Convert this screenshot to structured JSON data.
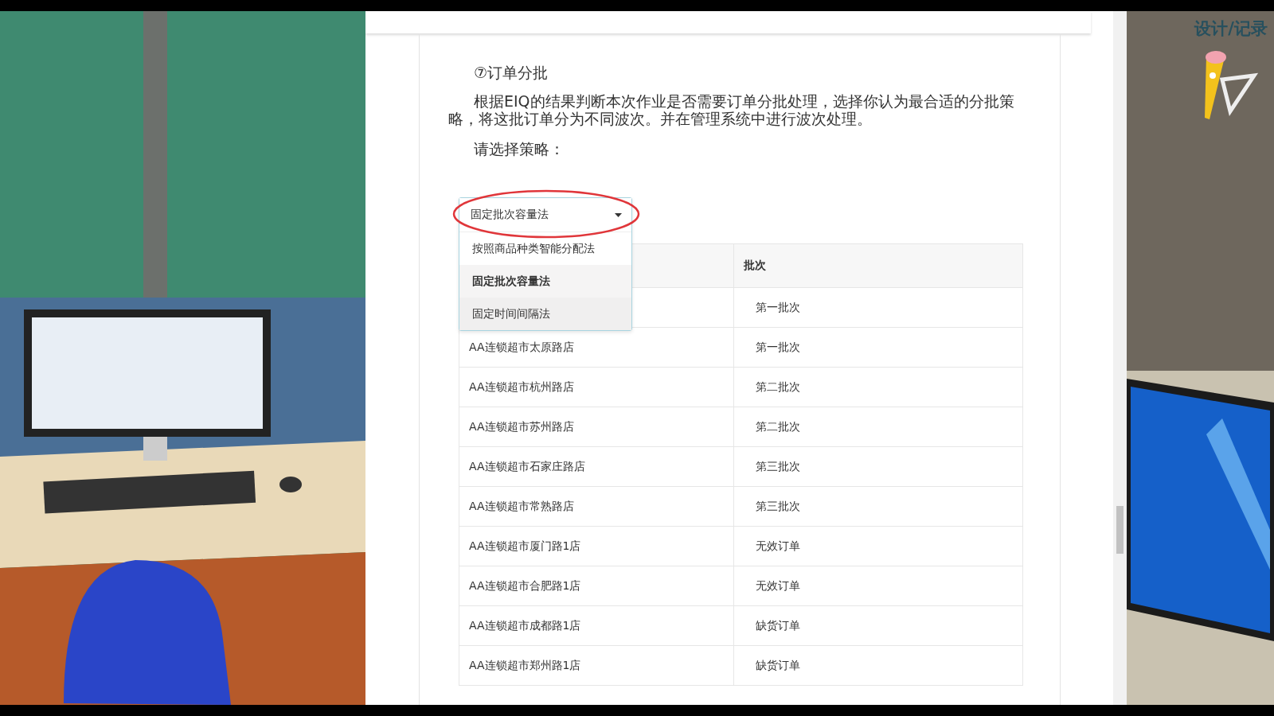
{
  "document": {
    "heading": "⑦订单分批",
    "paragraph": "根据EIQ的结果判断本次作业是否需要订单分批处理，选择你认为最合适的分批策略，将这批订单分为不同波次。并在管理系统中进行波次处理。",
    "prompt": "请选择策略："
  },
  "strategy_select": {
    "value": "固定批次容量法",
    "open": true,
    "circled": true,
    "options": [
      {
        "label": "按照商品种类智能分配法",
        "selected": false,
        "hovered": false
      },
      {
        "label": "固定批次容量法",
        "selected": true,
        "hovered": false
      },
      {
        "label": "固定时间间隔法",
        "selected": false,
        "hovered": true
      }
    ]
  },
  "table": {
    "columns": [
      "批次"
    ],
    "rows": [
      {
        "batch": "第一批次"
      },
      {
        "store": "AA连锁超市太原路店",
        "batch": "第一批次"
      },
      {
        "store": "AA连锁超市杭州路店",
        "batch": "第二批次"
      },
      {
        "store": "AA连锁超市苏州路店",
        "batch": "第二批次"
      },
      {
        "store": "AA连锁超市石家庄路店",
        "batch": "第三批次"
      },
      {
        "store": "AA连锁超市常熟路店",
        "batch": "第三批次"
      },
      {
        "store": "AA连锁超市厦门路1店",
        "batch": "无效订单"
      },
      {
        "store": "AA连锁超市合肥路1店",
        "batch": "无效订单"
      },
      {
        "store": "AA连锁超市成都路1店",
        "batch": "缺货订单"
      },
      {
        "store": "AA连锁超市郑州路1店",
        "batch": "缺货订单"
      }
    ]
  },
  "side_panel": {
    "title": "设计/记录"
  }
}
